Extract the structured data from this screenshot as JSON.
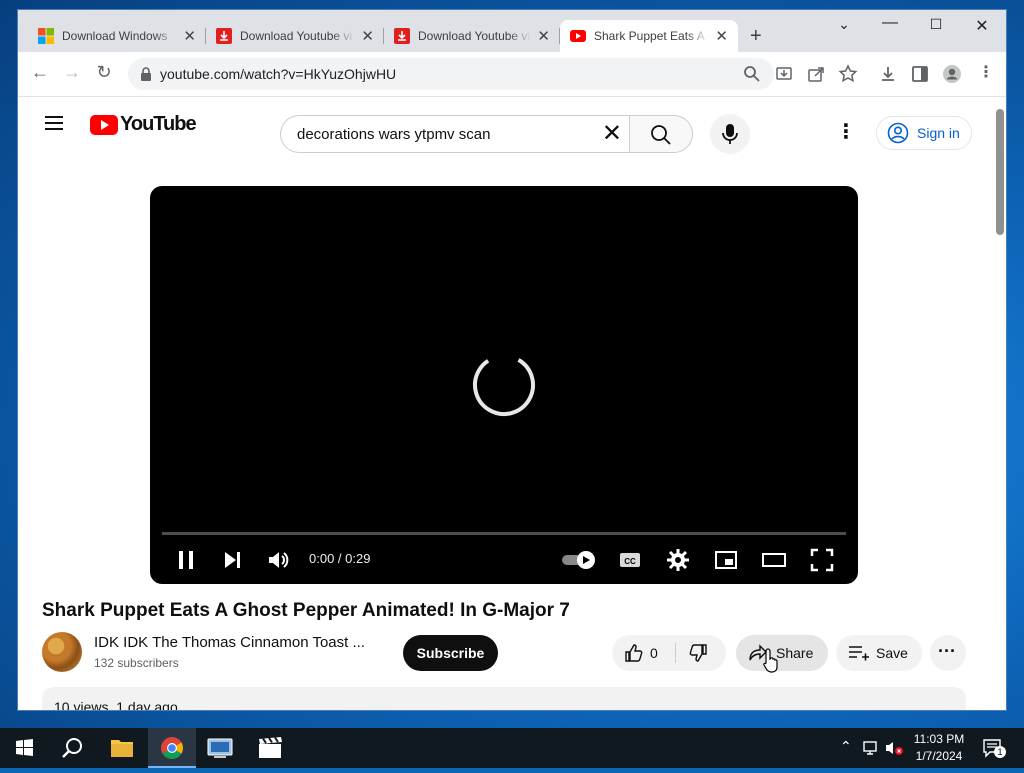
{
  "browser": {
    "tabs": [
      {
        "title": "Download Windows",
        "icon": "windows-icon"
      },
      {
        "title": "Download Youtube vi",
        "icon": "download-red-icon"
      },
      {
        "title": "Download Youtube vi",
        "icon": "download-red-icon"
      },
      {
        "title": "Shark Puppet Eats A",
        "icon": "youtube-icon",
        "active": true
      }
    ],
    "new_tab": "+",
    "url": "youtube.com/watch?v=HkYuzOhjwHU"
  },
  "youtube": {
    "logo_text": "YouTube",
    "search_query": "decorations wars ytpmv scan",
    "sign_in": "Sign in",
    "player": {
      "time": "0:00 / 0:29"
    },
    "video_title": "Shark Puppet Eats A Ghost Pepper Animated! In G-Major 7",
    "channel_name": "IDK IDK The Thomas Cinnamon Toast ...",
    "subscribers": "132 subscribers",
    "subscribe": "Subscribe",
    "likes": "0",
    "share": "Share",
    "save": "Save",
    "description_meta": "10 views  1 day ago"
  },
  "taskbar": {
    "time": "11:03 PM",
    "date": "1/7/2024",
    "notifications": "1"
  },
  "colors": {
    "youtube_red": "#ff0000",
    "link_blue": "#065fd4",
    "taskbar": "#101820"
  }
}
